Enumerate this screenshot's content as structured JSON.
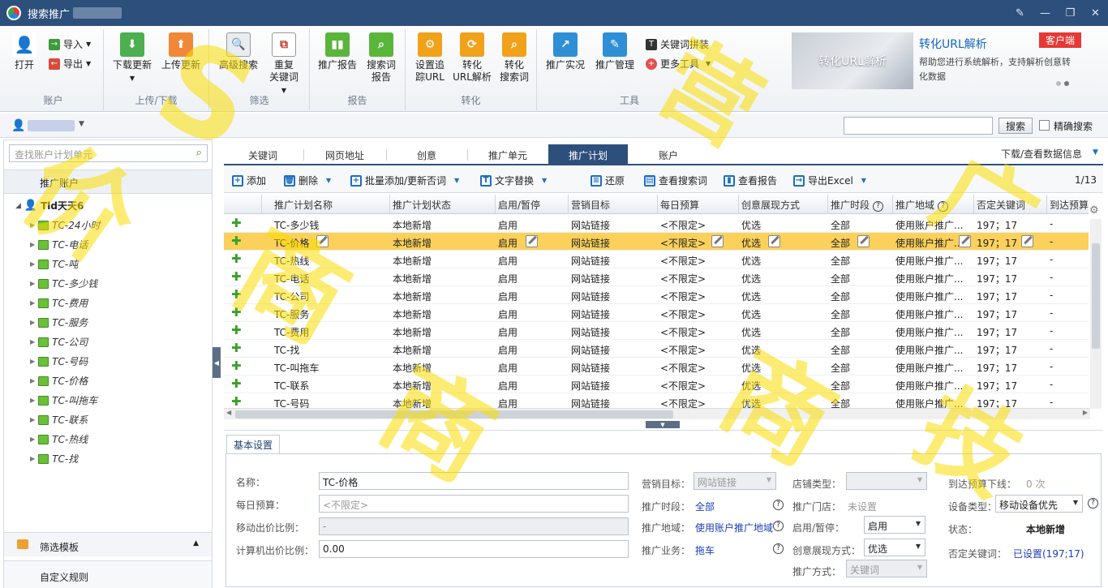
{
  "window": {
    "title": "搜索推广"
  },
  "ribbon": {
    "groups": [
      {
        "label": "账户"
      },
      {
        "label": "上传/下载"
      },
      {
        "label": "筛选"
      },
      {
        "label": "报告"
      },
      {
        "label": "转化"
      },
      {
        "label": "工具"
      }
    ],
    "open": "打开",
    "import": "导入",
    "export": "导出",
    "download_update": "下载更新",
    "upload_update": "上传更新",
    "advanced_search": "高级搜索",
    "duplicate_kw_1": "重复",
    "duplicate_kw_2": "关键词",
    "promo_report": "推广报告",
    "search_term_report_1": "搜索词",
    "search_term_report_2": "报告",
    "tracking_url_1": "设置追",
    "tracking_url_2": "踪URL",
    "convert_url_1": "转化",
    "convert_url_2": "URL解析",
    "convert_search_1": "转化",
    "convert_search_2": "搜索词",
    "promo_live": "推广实况",
    "promo_manage": "推广管理",
    "kw_combine": "关键词拼装",
    "more_tools": "更多工具"
  },
  "promo": {
    "image_text": "转化URL解析",
    "title": "转化URL解析",
    "desc": "帮助您进行系统解析，支持解析创意转化数据",
    "tag": "客户端"
  },
  "topbar": {
    "search_btn": "搜索",
    "exact_search": "精确搜索"
  },
  "left": {
    "search_placeholder": "查找账户计划单元",
    "header": "推广账户",
    "root": "Tld天天6",
    "plans": [
      "TC-24小时",
      "TC-电话",
      "TC-吨",
      "TC-多少钱",
      "TC-费用",
      "TC-服务",
      "TC-公司",
      "TC-号码",
      "TC-价格",
      "TC-叫拖车",
      "TC-联系",
      "TC-热线",
      "TC-找"
    ],
    "filter_template": "筛选模板",
    "custom_rules": "自定义规则"
  },
  "tabs": [
    "关键词",
    "网页地址",
    "创意",
    "推广单元",
    "推广计划",
    "账户"
  ],
  "download_link": "下载/查看数据信息",
  "toolbar": {
    "add": "添加",
    "delete": "删除",
    "batch_add": "批量添加/更新否词",
    "text_replace": "文字替换",
    "restore": "还原",
    "view_search_terms": "查看搜索词",
    "view_report": "查看报告",
    "export_excel": "导出Excel",
    "page": "1/13"
  },
  "grid": {
    "columns": [
      "推广计划名称",
      "推广计划状态",
      "启用/暂停",
      "营销目标",
      "每日预算",
      "创意展现方式",
      "推广时段",
      "推广地域",
      "否定关键词",
      "到达预算"
    ],
    "rows": [
      [
        "TC-多少钱",
        "本地新增",
        "启用",
        "网站链接",
        "<不限定>",
        "优选",
        "全部",
        "使用账户推广...",
        "197；17",
        "-"
      ],
      [
        "TC-价格",
        "本地新增",
        "启用",
        "网站链接",
        "<不限定>",
        "优选",
        "全部",
        "使用账户推广...",
        "197；17",
        "-"
      ],
      [
        "TC-热线",
        "本地新增",
        "启用",
        "网站链接",
        "<不限定>",
        "优选",
        "全部",
        "使用账户推广...",
        "197；17",
        "-"
      ],
      [
        "TC-电话",
        "本地新增",
        "启用",
        "网站链接",
        "<不限定>",
        "优选",
        "全部",
        "使用账户推广...",
        "197；17",
        "-"
      ],
      [
        "TC-公司",
        "本地新增",
        "启用",
        "网站链接",
        "<不限定>",
        "优选",
        "全部",
        "使用账户推广...",
        "197；17",
        "-"
      ],
      [
        "TC-服务",
        "本地新增",
        "启用",
        "网站链接",
        "<不限定>",
        "优选",
        "全部",
        "使用账户推广...",
        "197；17",
        "-"
      ],
      [
        "TC-费用",
        "本地新增",
        "启用",
        "网站链接",
        "<不限定>",
        "优选",
        "全部",
        "使用账户推广...",
        "197；17",
        "-"
      ],
      [
        "TC-找",
        "本地新增",
        "启用",
        "网站链接",
        "<不限定>",
        "优选",
        "全部",
        "使用账户推广...",
        "197；17",
        "-"
      ],
      [
        "TC-叫拖车",
        "本地新增",
        "启用",
        "网站链接",
        "<不限定>",
        "优选",
        "全部",
        "使用账户推广...",
        "197；17",
        "-"
      ],
      [
        "TC-联系",
        "本地新增",
        "启用",
        "网站链接",
        "<不限定>",
        "优选",
        "全部",
        "使用账户推广...",
        "197；17",
        "-"
      ],
      [
        "TC-号码",
        "本地新增",
        "启用",
        "网站链接",
        "<不限定>",
        "优选",
        "全部",
        "使用账户推广...",
        "197；17",
        "-"
      ]
    ],
    "selected_row": 1
  },
  "detail": {
    "tab": "基本设置",
    "name_label": "名称：",
    "name_value": "TC-价格",
    "budget_label": "每日预算：",
    "budget_placeholder": "<不限定>",
    "mobile_bid_label": "移动出价比例：",
    "mobile_bid_value": "-",
    "pc_bid_label": "计算机出价比例：",
    "pc_bid_value": "0.00",
    "marketing_label": "营销目标：",
    "marketing_value": "网站链接",
    "time_label": "推广时段：",
    "time_value": "全部",
    "region_label": "推广地域：",
    "region_value": "使用账户推广地域",
    "business_label": "推广业务：",
    "business_value": "拖车",
    "shop_type_label": "店铺类型：",
    "shop_label": "推广门店：",
    "shop_value": "未设置",
    "status_toggle_label": "启用/暂停：",
    "status_toggle_value": "启用",
    "creative_label": "创意展现方式：",
    "creative_value": "优选",
    "promo_method_label": "推广方式：",
    "promo_method_value": "关键词",
    "budget_reach_label": "到达预算下线：",
    "budget_reach_value": "0 次",
    "device_label": "设备类型：",
    "device_value": "移动设备优先",
    "state_label": "状态：",
    "state_value": "本地新增",
    "neg_kw_label": "否定关键词：",
    "neg_kw_value": "已设置(197;17)"
  }
}
